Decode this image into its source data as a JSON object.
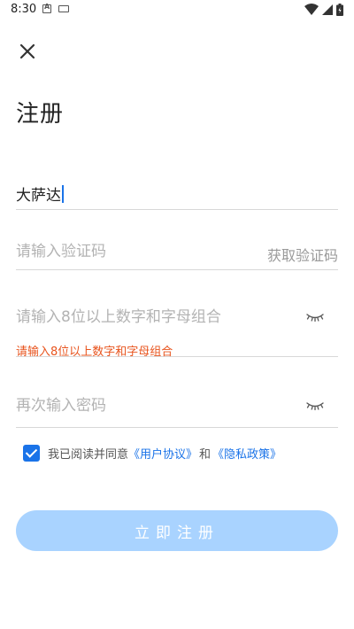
{
  "status_bar": {
    "time": "8:30"
  },
  "header": {
    "close_icon": "close-icon",
    "title": "注册"
  },
  "form": {
    "username": {
      "value": "大萨达"
    },
    "verify_code": {
      "placeholder": "请输入验证码",
      "get_code_label": "获取验证码"
    },
    "password": {
      "placeholder": "请输入8位以上数字和字母组合",
      "hint": "请输入8位以上数字和字母组合",
      "toggle_icon": "eye-closed-icon"
    },
    "confirm_password": {
      "placeholder": "再次输入密码",
      "toggle_icon": "eye-closed-icon"
    }
  },
  "agreement": {
    "checked": true,
    "prefix": "我已阅读并同意",
    "user_agreement": "《用户协议》",
    "and": "和",
    "privacy_policy": "《隐私政策》"
  },
  "submit": {
    "label": "立即注册"
  },
  "colors": {
    "accent": "#1a73e8",
    "hint": "#e8541e",
    "submit_bg": "#a9d3ff"
  }
}
